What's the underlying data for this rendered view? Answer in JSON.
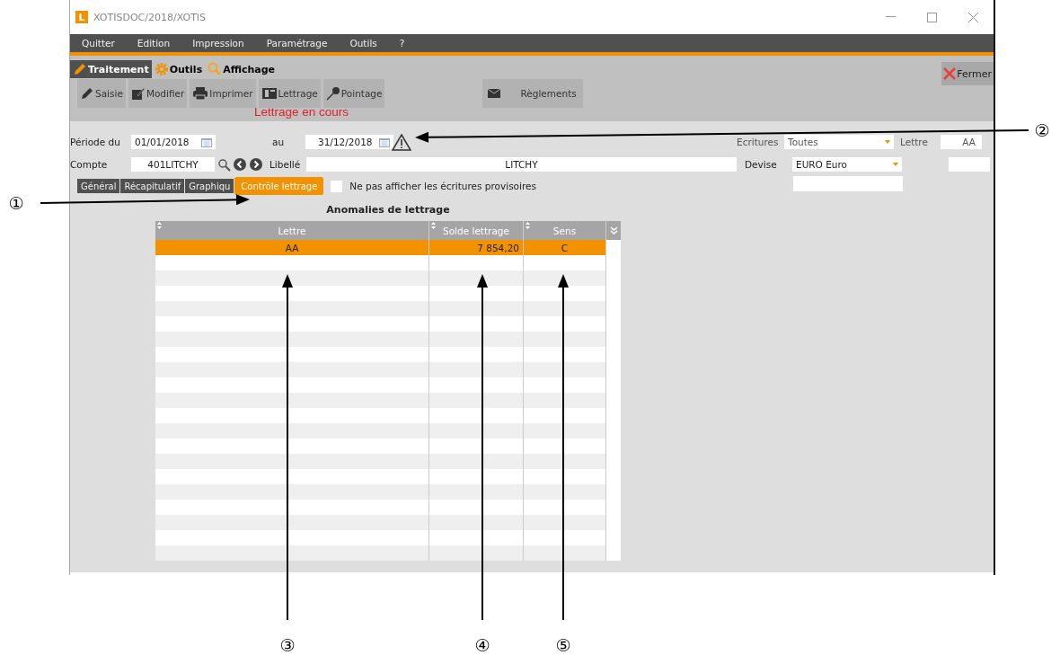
{
  "window": {
    "logo": "L",
    "title": "XOTISDOC/2018/XOTIS"
  },
  "menu": [
    {
      "label": "Quitter"
    },
    {
      "label": "Edition"
    },
    {
      "label": "Impression"
    },
    {
      "label": "Paramétrage"
    },
    {
      "label": "Outils"
    },
    {
      "label": "?"
    }
  ],
  "ribbon_tabs": [
    {
      "label": "Traitement",
      "selected": true
    },
    {
      "label": "Outils",
      "selected": false
    },
    {
      "label": "Affichage",
      "selected": false
    }
  ],
  "close_button": "Fermer",
  "toolbar": [
    {
      "label": "Saisie"
    },
    {
      "label": "Modifier"
    },
    {
      "label": "Imprimer"
    },
    {
      "label": "Lettrage"
    },
    {
      "label": "Pointage"
    }
  ],
  "reglements_button": "Règlements",
  "status_message": "Lettrage en cours",
  "form": {
    "period_label": "Période du",
    "date_from": "01/01/2018",
    "to_label": "au",
    "date_to": "31/12/2018",
    "account_label": "Compte",
    "account": "401LITCHY",
    "libelle_label": "Libellé",
    "libelle": "LITCHY",
    "ecritures_label": "Ecritures",
    "ecritures": "Toutes",
    "lettre_label": "Lettre",
    "lettre": "AA",
    "devise_label": "Devise",
    "devise": "EURO Euro"
  },
  "view_tabs": [
    {
      "label": "Général",
      "selected": false
    },
    {
      "label": "Récapitulatif",
      "selected": false
    },
    {
      "label": "Graphiqu",
      "selected": false
    },
    {
      "label": "Contrôle lettrage",
      "selected": true
    }
  ],
  "hide_provisional": {
    "label": "Ne pas afficher les écritures provisoires",
    "checked": false
  },
  "table": {
    "title": "Anomalies de lettrage",
    "columns": [
      "Lettre",
      "Solde lettrage",
      "Sens"
    ],
    "rows": [
      {
        "cells": [
          "AA",
          "7 854,20",
          "C"
        ],
        "selected": true
      }
    ]
  },
  "callouts": [
    {
      "label": "①"
    },
    {
      "label": "②"
    },
    {
      "label": "③"
    },
    {
      "label": "④"
    },
    {
      "label": "⑤"
    }
  ]
}
